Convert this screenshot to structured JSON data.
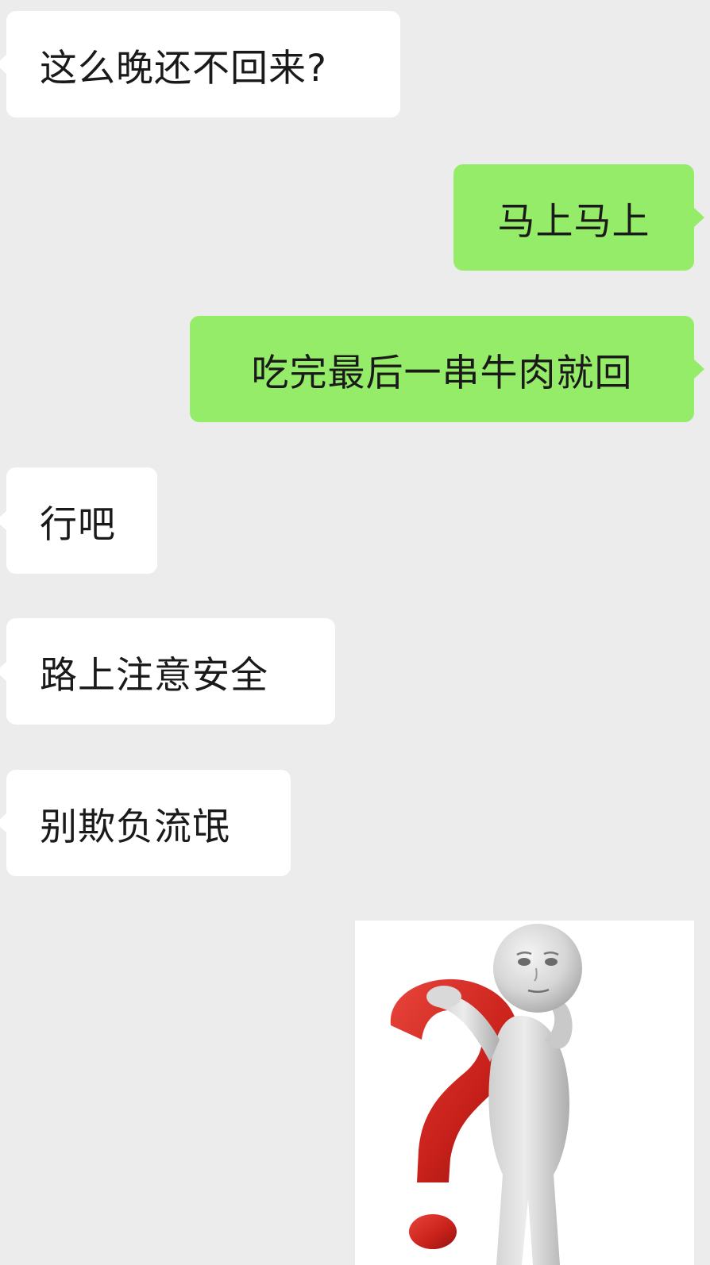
{
  "chat": {
    "messages": [
      {
        "side": "incoming",
        "text": "这么晚还不回来?"
      },
      {
        "side": "outgoing",
        "text": "马上马上"
      },
      {
        "side": "outgoing",
        "text": "吃完最后一串牛肉就回"
      },
      {
        "side": "incoming",
        "text": "行吧"
      },
      {
        "side": "incoming",
        "text": "路上注意安全"
      },
      {
        "side": "incoming",
        "text": "别欺负流氓"
      }
    ],
    "sticker": {
      "icon": "question-mark-figure-sticker"
    }
  },
  "colors": {
    "background": "#ececec",
    "incoming_bubble": "#ffffff",
    "outgoing_bubble": "#95ec69",
    "sticker_question_mark": "#d42a22"
  }
}
